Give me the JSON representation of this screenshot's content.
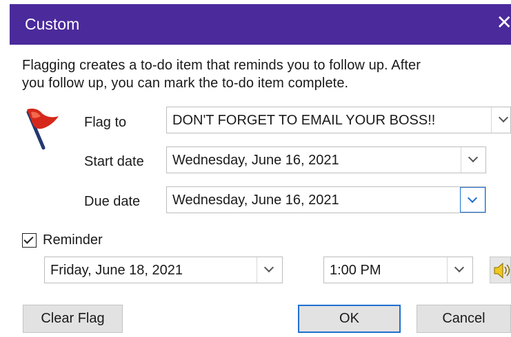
{
  "dialog": {
    "title": "Custom",
    "close_glyph": "✕",
    "message_line1": "Flagging creates a to-do item that reminds you to follow up. After",
    "message_line2": "you follow up, you can mark the to-do item complete."
  },
  "icons": {
    "flag": "flag-icon",
    "dropdown": "chevron-down-icon",
    "speaker": "speaker-icon",
    "close": "close-icon"
  },
  "flag_to": {
    "label": "Flag to",
    "value": "DON'T FORGET TO EMAIL YOUR BOSS!!"
  },
  "start_date": {
    "label": "Start date",
    "value": "Wednesday, June 16, 2021"
  },
  "due_date": {
    "label": "Due date",
    "value": "Wednesday, June 16, 2021"
  },
  "reminder": {
    "label": "Reminder",
    "checked": true,
    "date": "Friday, June 18, 2021",
    "time": "1:00 PM"
  },
  "buttons": {
    "clear_flag": "Clear Flag",
    "ok": "OK",
    "cancel": "Cancel"
  },
  "colors": {
    "titlebar": "#4b2a9b",
    "focus_blue": "#1e6fcf",
    "flag_red": "#d6281a"
  }
}
